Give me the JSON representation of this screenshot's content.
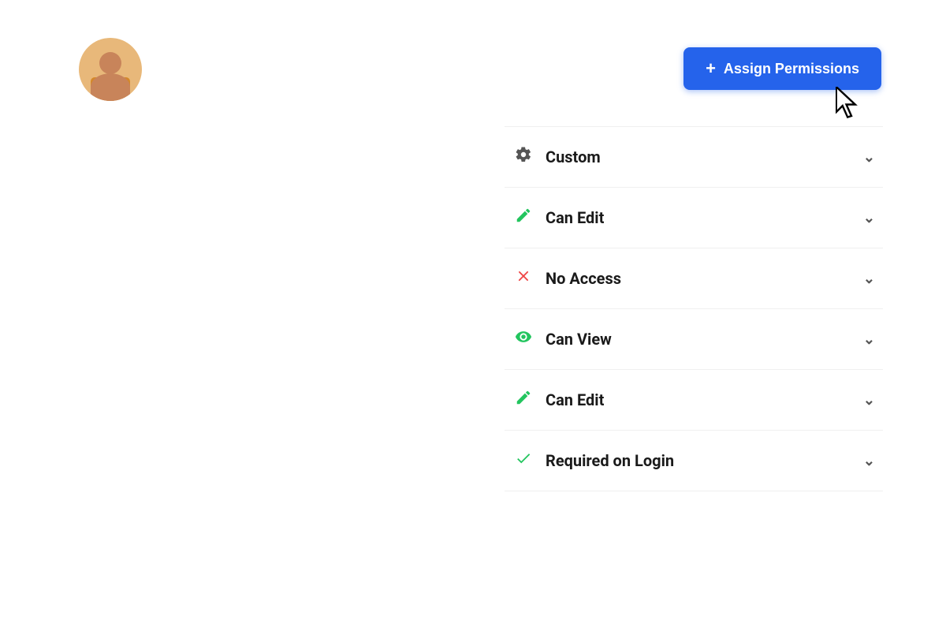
{
  "header": {
    "assign_button_label": "Assign Permissions",
    "assign_button_plus": "+"
  },
  "avatar": {
    "alt": "User avatar"
  },
  "permissions": {
    "items": [
      {
        "id": "custom",
        "label": "Custom",
        "icon": "gear-icon"
      },
      {
        "id": "can-edit-1",
        "label": "Can Edit",
        "icon": "pencil-icon-green"
      },
      {
        "id": "no-access",
        "label": "No Access",
        "icon": "x-icon-red"
      },
      {
        "id": "can-view",
        "label": "Can View",
        "icon": "eye-icon-green"
      },
      {
        "id": "can-edit-2",
        "label": "Can Edit",
        "icon": "pencil-icon-green"
      },
      {
        "id": "required-on-login",
        "label": "Required on Login",
        "icon": "check-icon-green"
      }
    ]
  },
  "colors": {
    "primary_blue": "#2563eb",
    "green": "#22c55e",
    "red": "#ef4444",
    "dark_text": "#1a1a1a",
    "gray_icon": "#555555"
  }
}
